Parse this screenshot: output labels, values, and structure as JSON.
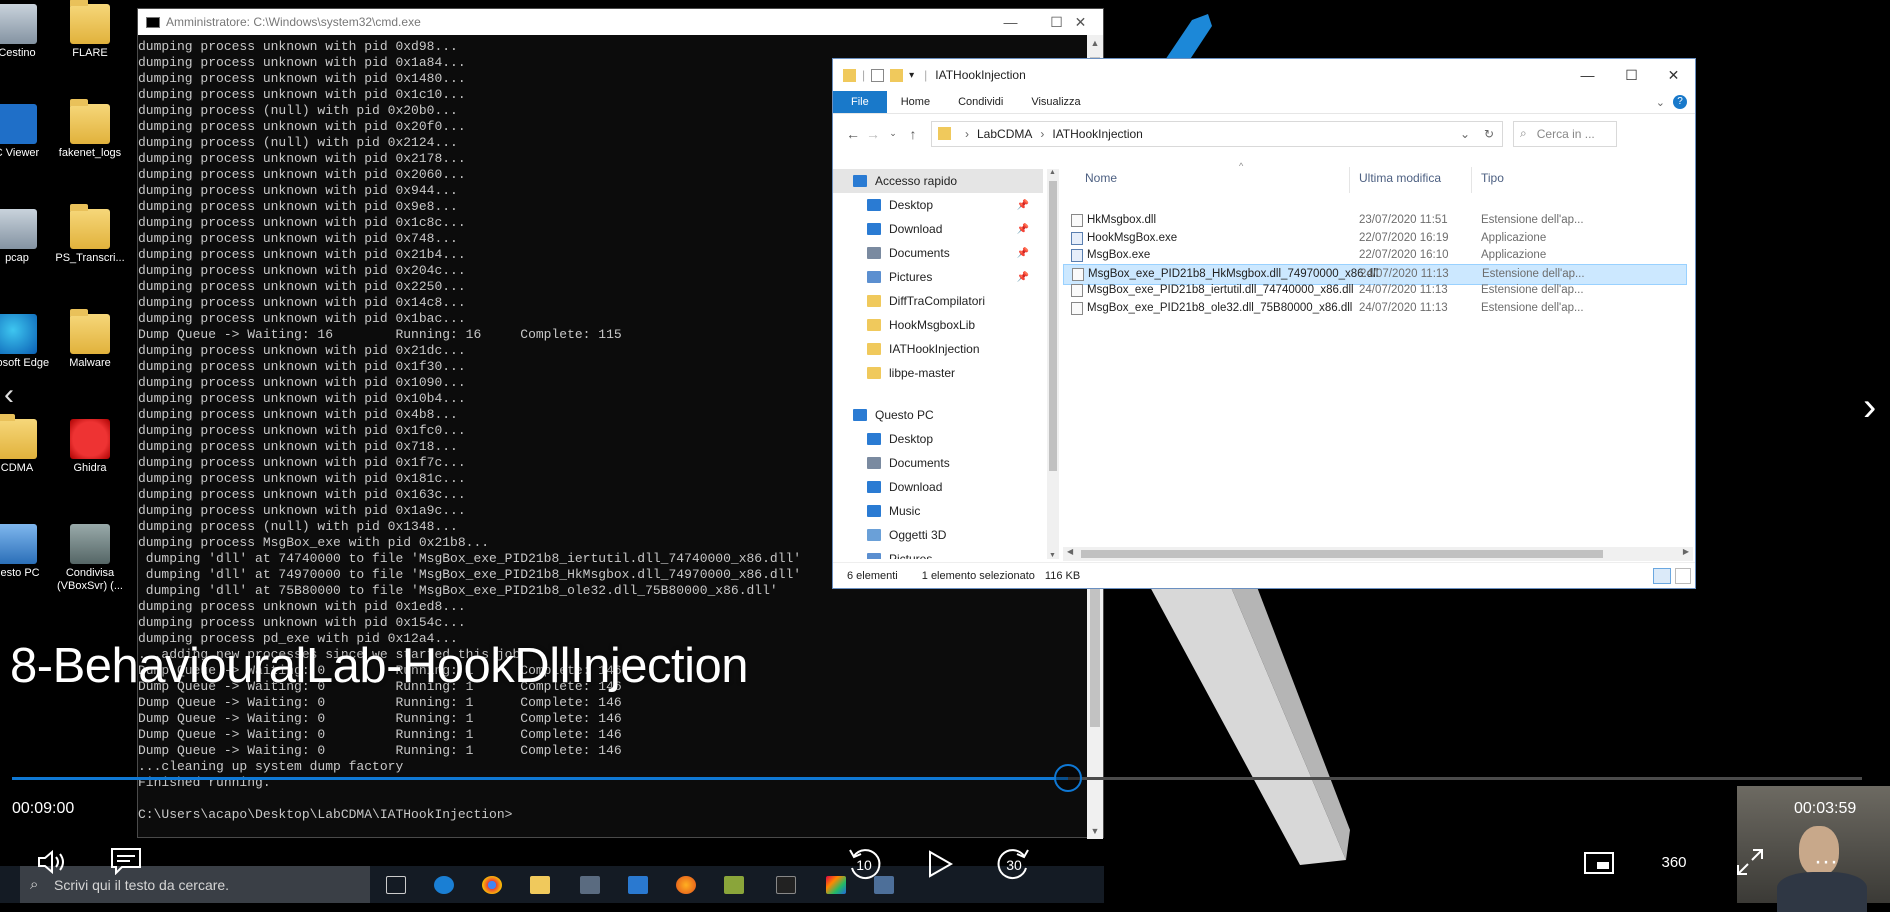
{
  "desktop": {
    "icons": [
      {
        "label": "Cestino",
        "kind": "recycle-bin"
      },
      {
        "label": "FLARE",
        "kind": "folder"
      },
      {
        "label": "C Viewer",
        "kind": "app"
      },
      {
        "label": "fakenet_logs",
        "kind": "folder"
      },
      {
        "label": "pcap",
        "kind": "file"
      },
      {
        "label": "PS_Transcri...",
        "kind": "folder"
      },
      {
        "label": "icrosoft Edge",
        "kind": "edge"
      },
      {
        "label": "Malware",
        "kind": "folder"
      },
      {
        "label": "CDMA",
        "kind": "folder"
      },
      {
        "label": "Ghidra",
        "kind": "ghidra"
      },
      {
        "label": "uesto PC",
        "kind": "pc"
      },
      {
        "label": "Condivisa (VBoxSvr) (...",
        "kind": "network-share"
      }
    ]
  },
  "cmd": {
    "title": "Amministratore: C:\\Windows\\system32\\cmd.exe",
    "lines": [
      "dumping process unknown with pid 0xd98...",
      "dumping process unknown with pid 0x1a84...",
      "dumping process unknown with pid 0x1480...",
      "dumping process unknown with pid 0x1c10...",
      "dumping process (null) with pid 0x20b0...",
      "dumping process unknown with pid 0x20f0...",
      "dumping process (null) with pid 0x2124...",
      "dumping process unknown with pid 0x2178...",
      "dumping process unknown with pid 0x2060...",
      "dumping process unknown with pid 0x944...",
      "dumping process unknown with pid 0x9e8...",
      "dumping process unknown with pid 0x1c8c...",
      "dumping process unknown with pid 0x748...",
      "dumping process unknown with pid 0x21b4...",
      "dumping process unknown with pid 0x204c...",
      "dumping process unknown with pid 0x2250...",
      "dumping process unknown with pid 0x14c8...",
      "dumping process unknown with pid 0x1bac...",
      "Dump Queue -> Waiting: 16        Running: 16     Complete: 115",
      "dumping process unknown with pid 0x21dc...",
      "dumping process unknown with pid 0x1f30...",
      "dumping process unknown with pid 0x1090...",
      "dumping process unknown with pid 0x10b4...",
      "dumping process unknown with pid 0x4b8...",
      "dumping process unknown with pid 0x1fc0...",
      "dumping process unknown with pid 0x718...",
      "dumping process unknown with pid 0x1f7c...",
      "dumping process unknown with pid 0x181c...",
      "dumping process unknown with pid 0x163c...",
      "dumping process unknown with pid 0x1a9c...",
      "dumping process (null) with pid 0x1348...",
      "dumping process MsgBox_exe with pid 0x21b8...",
      " dumping 'dll' at 74740000 to file 'MsgBox_exe_PID21b8_iertutil.dll_74740000_x86.dll'",
      " dumping 'dll' at 74970000 to file 'MsgBox_exe_PID21b8_HkMsgbox.dll_74970000_x86.dll'",
      " dumping 'dll' at 75B80000 to file 'MsgBox_exe_PID21b8_ole32.dll_75B80000_x86.dll'",
      "dumping process unknown with pid 0x1ed8...",
      "dumping process unknown with pid 0x154c...",
      "dumping process pd_exe with pid 0x12a4...",
      "...adding new processes since we started this job",
      "Dump Queue -> Waiting: 0         Running: 1      Complete: 146",
      "Dump Queue -> Waiting: 0         Running: 1      Complete: 146",
      "Dump Queue -> Waiting: 0         Running: 1      Complete: 146",
      "Dump Queue -> Waiting: 0         Running: 1      Complete: 146",
      "Dump Queue -> Waiting: 0         Running: 1      Complete: 146",
      "Dump Queue -> Waiting: 0         Running: 1      Complete: 146",
      "...cleaning up system dump factory",
      "Finished running.",
      "",
      "C:\\Users\\acapo\\Desktop\\LabCDMA\\IATHookInjection>"
    ]
  },
  "explorer": {
    "title": "IATHookInjection",
    "ribbon_tabs": [
      "File",
      "Home",
      "Condividi",
      "Visualizza"
    ],
    "address": [
      "LabCDMA",
      "IATHookInjection"
    ],
    "search_placeholder": "Cerca in ...",
    "tree": [
      {
        "label": "Accesso rapido",
        "icon": "star",
        "selected": true,
        "pinned": false,
        "level": 0
      },
      {
        "label": "Desktop",
        "icon": "desktop",
        "pinned": true,
        "level": 1
      },
      {
        "label": "Download",
        "icon": "download",
        "pinned": true,
        "level": 1
      },
      {
        "label": "Documents",
        "icon": "document",
        "pinned": true,
        "level": 1
      },
      {
        "label": "Pictures",
        "icon": "picture",
        "pinned": true,
        "level": 1
      },
      {
        "label": "DiffTraCompilatori",
        "icon": "folder",
        "pinned": false,
        "level": 1
      },
      {
        "label": "HookMsgboxLib",
        "icon": "folder",
        "pinned": false,
        "level": 1
      },
      {
        "label": "IATHookInjection",
        "icon": "folder",
        "pinned": false,
        "level": 1
      },
      {
        "label": "libpe-master",
        "icon": "folder",
        "pinned": false,
        "level": 1
      },
      {
        "label": "Questo PC",
        "icon": "pc",
        "pinned": false,
        "level": 0
      },
      {
        "label": "Desktop",
        "icon": "desktop",
        "pinned": false,
        "level": 1
      },
      {
        "label": "Documents",
        "icon": "document",
        "pinned": false,
        "level": 1
      },
      {
        "label": "Download",
        "icon": "download",
        "pinned": false,
        "level": 1
      },
      {
        "label": "Music",
        "icon": "music",
        "pinned": false,
        "level": 1
      },
      {
        "label": "Oggetti 3D",
        "icon": "cube",
        "pinned": false,
        "level": 1
      },
      {
        "label": "Pictures",
        "icon": "picture",
        "pinned": false,
        "level": 1
      }
    ],
    "columns": [
      "Nome",
      "Ultima modifica",
      "Tipo"
    ],
    "files": [
      {
        "name": "HkMsgbox.dll",
        "modified": "23/07/2020 11:51",
        "type": "Estensione dell'ap...",
        "icon": "dll",
        "selected": false
      },
      {
        "name": "HookMsgBox.exe",
        "modified": "22/07/2020 16:19",
        "type": "Applicazione",
        "icon": "exe",
        "selected": false
      },
      {
        "name": "MsgBox.exe",
        "modified": "22/07/2020 16:10",
        "type": "Applicazione",
        "icon": "exe",
        "selected": false
      },
      {
        "name": "MsgBox_exe_PID21b8_HkMsgbox.dll_74970000_x86.dll",
        "modified": "24/07/2020 11:13",
        "type": "Estensione dell'ap...",
        "icon": "dll",
        "selected": true
      },
      {
        "name": "MsgBox_exe_PID21b8_iertutil.dll_74740000_x86.dll",
        "modified": "24/07/2020 11:13",
        "type": "Estensione dell'ap...",
        "icon": "dll",
        "selected": false
      },
      {
        "name": "MsgBox_exe_PID21b8_ole32.dll_75B80000_x86.dll",
        "modified": "24/07/2020 11:13",
        "type": "Estensione dell'ap...",
        "icon": "dll",
        "selected": false
      }
    ],
    "status": {
      "count": "6 elementi",
      "selection": "1 elemento selezionato",
      "size": "116 KB"
    }
  },
  "player": {
    "title": "8-BehaviouralLab-HookDllInjection",
    "elapsed": "00:09:00",
    "remaining": "00:03:59",
    "progress": 0.571,
    "rewind_seconds": "10",
    "forward_seconds": "30",
    "vr_label": "360"
  },
  "taskbar": {
    "search_placeholder": "Scrivi qui il testo da cercare."
  },
  "colors": {
    "accent": "#0f78d4",
    "file_tab": "#1979ca",
    "selection": "#cce8ff",
    "console_bg": "#0c0c0c",
    "console_text": "#c8c8c8"
  }
}
